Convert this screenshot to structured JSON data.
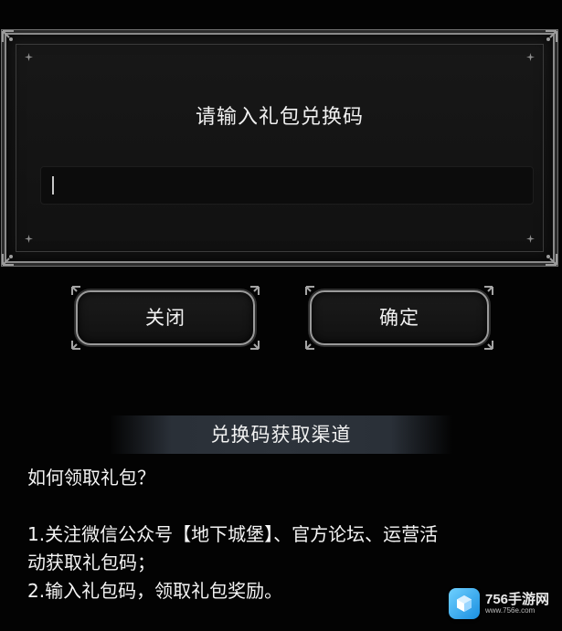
{
  "dialog": {
    "title": "请输入礼包兑换码",
    "input_value": "",
    "input_placeholder": ""
  },
  "buttons": {
    "close_label": "关闭",
    "confirm_label": "确定"
  },
  "info": {
    "header": "兑换码获取渠道",
    "question": "如何领取礼包？",
    "step1_line1": "1.关注微信公众号【地下城堡】、官方论坛、运营活",
    "step1_line2": "动获取礼包码；",
    "step2": "2.输入礼包码，领取礼包奖励。"
  },
  "watermark": {
    "name": "756手游网",
    "url": "www.756e.com"
  },
  "colors": {
    "background": "#030303",
    "panel": "#151515",
    "frame": "#8a8a8a",
    "text": "#f0f0f0",
    "header_bar": "#2d333b",
    "watermark_blue": "#1a8fe0"
  },
  "icons": {
    "corner": "ornate-corner-icon",
    "spark": "four-point-star-icon",
    "logo": "cube-logo-icon"
  }
}
